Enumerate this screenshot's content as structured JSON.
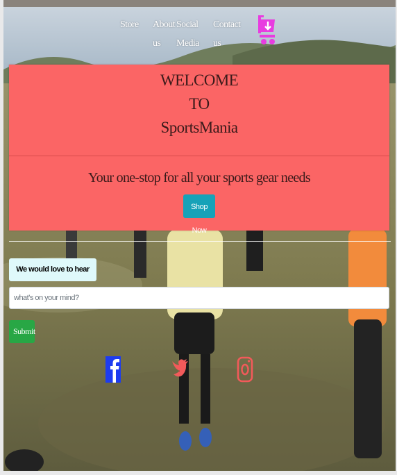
{
  "nav": {
    "items": [
      {
        "label_line1": "Store",
        "label_line2": ""
      },
      {
        "label_line1": "About",
        "label_line2": "us"
      },
      {
        "label_line1": "Social",
        "label_line2": "Media"
      },
      {
        "label_line1": "Contact",
        "label_line2": "us"
      }
    ],
    "cart_icon": "shopping-cart-icon",
    "cart_color": "#e83ce0"
  },
  "welcome": {
    "line1": "WELCOME",
    "line2": "TO",
    "line3": "SportsMania",
    "tagline": "Your one-stop for all your sports gear needs",
    "shop_button": "Shop Now",
    "background": "#fb6565"
  },
  "feedback": {
    "label": "We would love to hear from you",
    "placeholder": "what's on your mind?",
    "submit_label": "Submit"
  },
  "social": {
    "facebook": {
      "icon": "facebook-icon",
      "color": "#1d3cf0"
    },
    "twitter": {
      "icon": "twitter-icon",
      "color": "#f25a5a"
    },
    "instagram": {
      "icon": "instagram-icon",
      "color": "#f25a5a"
    }
  }
}
